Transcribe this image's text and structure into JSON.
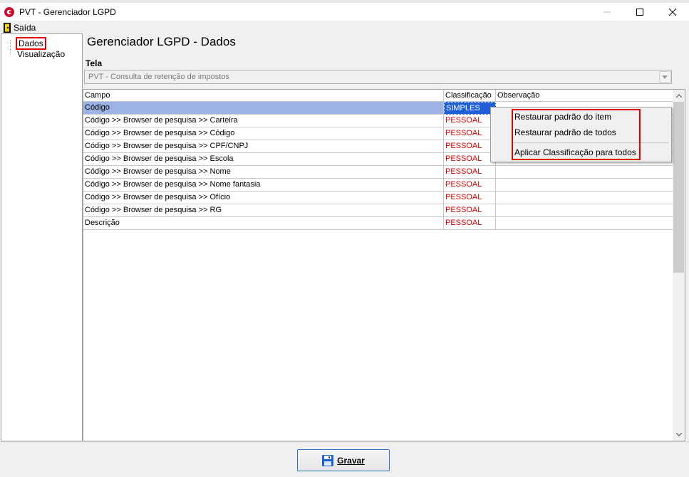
{
  "window": {
    "title": "PVT - Gerenciador LGPD",
    "minimize_glyph": "—",
    "maximize_glyph": "☐",
    "close_glyph": "✕"
  },
  "menu": {
    "exit_label": "Saída"
  },
  "tree": {
    "items": [
      {
        "label": "Dados"
      },
      {
        "label": "Visualização"
      }
    ]
  },
  "main": {
    "heading": "Gerenciador LGPD - Dados",
    "tela_label": "Tela",
    "tela_value": "PVT - Consulta de retenção de impostos"
  },
  "grid": {
    "columns": [
      "Campo",
      "Classificação",
      "Observação"
    ],
    "rows": [
      {
        "campo": "Código",
        "classificacao": "SIMPLES",
        "observacao": ""
      },
      {
        "campo": "Código >> Browser de pesquisa >> Carteira",
        "classificacao": "PESSOAL",
        "observacao": ""
      },
      {
        "campo": "Código >> Browser de pesquisa >> Código",
        "classificacao": "PESSOAL",
        "observacao": ""
      },
      {
        "campo": "Código >> Browser de pesquisa >> CPF/CNPJ",
        "classificacao": "PESSOAL",
        "observacao": ""
      },
      {
        "campo": "Código >> Browser de pesquisa >> Escola",
        "classificacao": "PESSOAL",
        "observacao": ""
      },
      {
        "campo": "Código >> Browser de pesquisa >> Nome",
        "classificacao": "PESSOAL",
        "observacao": ""
      },
      {
        "campo": "Código >> Browser de pesquisa >> Nome fantasia",
        "classificacao": "PESSOAL",
        "observacao": ""
      },
      {
        "campo": "Código >> Browser de pesquisa >> Ofício",
        "classificacao": "PESSOAL",
        "observacao": ""
      },
      {
        "campo": "Código >> Browser de pesquisa >> RG",
        "classificacao": "PESSOAL",
        "observacao": ""
      },
      {
        "campo": "Descrição",
        "classificacao": "PESSOAL",
        "observacao": ""
      }
    ]
  },
  "context_menu": {
    "items": [
      {
        "label": "Restaurar padrão do item"
      },
      {
        "label": "Restaurar padrão de todos"
      },
      {
        "label": "Aplicar Classificação para todos"
      }
    ]
  },
  "footer": {
    "save_label": "Gravar"
  },
  "colors": {
    "accent_red": "#e00000",
    "selected_blue": "#1f5fd6",
    "row_highlight": "#9db3e6"
  }
}
